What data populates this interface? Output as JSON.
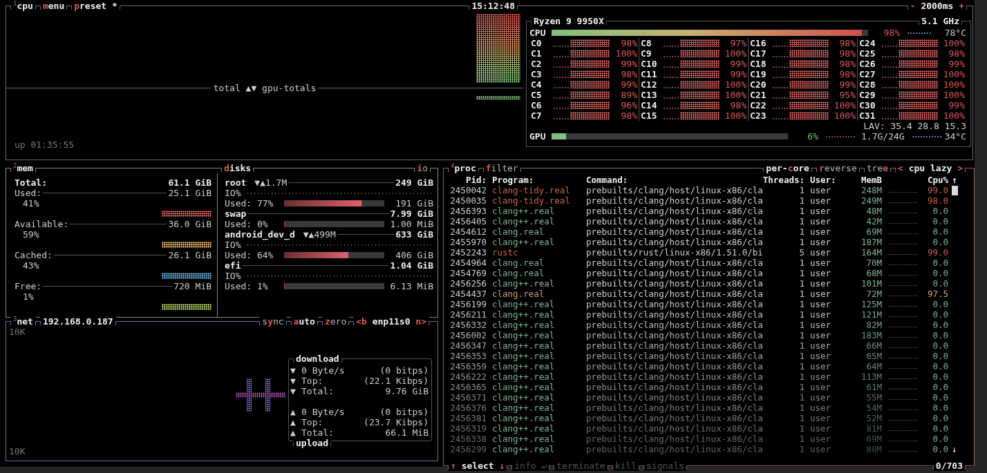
{
  "cpu_panel": {
    "title": "$^{1}$cpu",
    "options": [
      {
        "kind": "button",
        "text": "**m**enu"
      },
      {
        "kind": "button",
        "text": "**p**reset *"
      }
    ],
    "clock": "15:12:48",
    "interval": {
      "minus": "-",
      "value": "2000ms",
      "plus": "+"
    },
    "graph_legend": "total ▲▼ gpu-totals",
    "uptime": "up 01:35:55",
    "cpu_box": {
      "model": "Ryzen 9 9950X",
      "frequency": "5.1 GHz",
      "total": {
        "label": "CPU",
        "level": 0.98,
        "percent": "98%",
        "temperature": "78°C"
      },
      "cores": [
        {
          "label": "C0",
          "value": "98%"
        },
        {
          "label": "C1",
          "value": "100%"
        },
        {
          "label": "C2",
          "value": "99%"
        },
        {
          "label": "C3",
          "value": "98%"
        },
        {
          "label": "C4",
          "value": "99%"
        },
        {
          "label": "C5",
          "value": "89%"
        },
        {
          "label": "C6",
          "value": "96%"
        },
        {
          "label": "C7",
          "value": "98%"
        },
        {
          "label": "C8",
          "value": "97%"
        },
        {
          "label": "C9",
          "value": "100%"
        },
        {
          "label": "C10",
          "value": "99%"
        },
        {
          "label": "C11",
          "value": "99%"
        },
        {
          "label": "C12",
          "value": "100%"
        },
        {
          "label": "C13",
          "value": "100%"
        },
        {
          "label": "C14",
          "value": "98%"
        },
        {
          "label": "C15",
          "value": "100%"
        },
        {
          "label": "C16",
          "value": "98%"
        },
        {
          "label": "C17",
          "value": "98%"
        },
        {
          "label": "C18",
          "value": "98%"
        },
        {
          "label": "C19",
          "value": "98%"
        },
        {
          "label": "C20",
          "value": "99%"
        },
        {
          "label": "C21",
          "value": "95%"
        },
        {
          "label": "C22",
          "value": "100%"
        },
        {
          "label": "C23",
          "value": "100%"
        },
        {
          "label": "C24",
          "value": "100%"
        },
        {
          "label": "C25",
          "value": "98%"
        },
        {
          "label": "C26",
          "value": "99%"
        },
        {
          "label": "C27",
          "value": "100%"
        },
        {
          "label": "C28",
          "value": "100%"
        },
        {
          "label": "C29",
          "value": "100%"
        },
        {
          "label": "C30",
          "value": "99%"
        },
        {
          "label": "C31",
          "value": "100%"
        }
      ],
      "load_average": "LAV: 35.4 28.8 15.3",
      "gpu": {
        "label": "GPU",
        "level": 0.06,
        "percent": "6%",
        "memory": "1.7G/24G",
        "temperature": "34°C"
      }
    }
  },
  "mem_panel": {
    "title": "$^{2}$mem",
    "disks_title": "**d**isks",
    "io_title": "**i**o",
    "total": {
      "label": "Total:",
      "value": "61.1 GiB"
    },
    "items": [
      {
        "label": "Used:",
        "value": "25.1 GiB",
        "percent": "41%",
        "color": "#d05a5a"
      },
      {
        "label": "Available:",
        "value": "36.0 GiB",
        "percent": "59%",
        "color": "#e0a85a"
      },
      {
        "label": "Cached:",
        "value": "26.1 GiB",
        "percent": "43%",
        "color": "#5aa8d8"
      },
      {
        "label": "Free:",
        "value": "720 MiB",
        "percent": "1%",
        "color": "#a8c85a"
      }
    ],
    "disks": [
      {
        "name": "root",
        "io": "▼▲1.7M",
        "size": "249 GiB",
        "io_label": "IO%",
        "used_label": "Used: 77%",
        "level": 0.77,
        "used": "191 GiB"
      },
      {
        "name": "swap",
        "size": "7.99 GiB",
        "used_label": "Used:  0%",
        "level": 0,
        "used": "1.00 MiB"
      },
      {
        "name": "android_dev_d",
        "io": "▼▲499M",
        "size": "633 GiB",
        "io_label": "IO%",
        "used_label": "Used: 64%",
        "level": 0.64,
        "used": "406 GiB"
      },
      {
        "name": "efi",
        "size": "1.04 GiB",
        "io_label": "IO%",
        "used_label": "Used:  1%",
        "level": 0.01,
        "used": "6.13 MiB"
      }
    ]
  },
  "net_panel": {
    "title": "$^{3}$net",
    "address": "192.168.0.187",
    "options": [
      {
        "kind": "toggle",
        "text": "s**y**nc",
        "on": false
      },
      {
        "kind": "toggle",
        "text": "**a**uto",
        "on": true
      },
      {
        "kind": "toggle",
        "text": "**z**ero",
        "on": false
      }
    ],
    "interface": {
      "prev": "<b",
      "label": "enp11s0",
      "next": "n>"
    },
    "scale_top": "10K",
    "scale_bottom": "10K",
    "download": {
      "title": "download",
      "rows": [
        {
          "arrow": "▼",
          "label": "0 Byte/s",
          "value": "(0 bitps)"
        },
        {
          "arrow": "▼",
          "label": "Top:",
          "value": "(22.1 Kibps)"
        },
        {
          "arrow": "▼",
          "label": "Total:",
          "value": "9.76 GiB"
        }
      ]
    },
    "upload": {
      "title": "upload",
      "rows": [
        {
          "arrow": "▲",
          "label": "0 Byte/s",
          "value": "(0 bitps)"
        },
        {
          "arrow": "▲",
          "label": "Top:",
          "value": "(23.7 Kibps)"
        },
        {
          "arrow": "▲",
          "label": "Total:",
          "value": "66.1 MiB"
        }
      ]
    }
  },
  "proc_panel": {
    "title": "$^{4}$proc",
    "options": [
      {
        "kind": "toggle",
        "text": "**f**ilter",
        "on": false
      }
    ],
    "right_options": [
      {
        "kind": "toggle",
        "text": "per-**c**ore",
        "on": true
      },
      {
        "kind": "toggle",
        "text": "**r**everse",
        "on": false
      },
      {
        "kind": "toggle",
        "text": "tre**e**",
        "on": false
      }
    ],
    "sorting": {
      "prev": "<",
      "label": "cpu lazy",
      "next": ">"
    },
    "columns": [
      "Pid:",
      "Program:",
      "Command:",
      "Threads:",
      "User:",
      "MemB",
      "Cpu%"
    ],
    "scrollbar": {
      "up": "↑",
      "down": "↓"
    },
    "rows": [
      {
        "pid": "2450042",
        "program": "clang-tidy.real",
        "command": "prebuilts/clang/host/linux-x86/cla",
        "threads": "1",
        "user": "user",
        "mem": "248M",
        "cpu": "99.0",
        "color": "#c8604c"
      },
      {
        "pid": "2450035",
        "program": "clang-tidy.real",
        "command": "prebuilts/clang/host/linux-x86/cla",
        "threads": "1",
        "user": "user",
        "mem": "249M",
        "cpu": "98.0",
        "color": "#c8604c"
      },
      {
        "pid": "2456393",
        "program": "clang++.real",
        "command": "prebuilts/clang/host/linux-x86/cla",
        "threads": "1",
        "user": "user",
        "mem": "48M",
        "cpu": "0.0",
        "color": "#80b494"
      },
      {
        "pid": "2456405",
        "program": "clang++.real",
        "command": "prebuilts/clang/host/linux-x86/cla",
        "threads": "1",
        "user": "user",
        "mem": "42M",
        "cpu": "0.0",
        "color": "#80b494"
      },
      {
        "pid": "2454612",
        "program": "clang.real",
        "command": "prebuilts/clang/host/linux-x86/cla",
        "threads": "1",
        "user": "user",
        "mem": "69M",
        "cpu": "0.0",
        "color": "#80b494"
      },
      {
        "pid": "2455970",
        "program": "clang++.real",
        "command": "prebuilts/clang/host/linux-x86/cla",
        "threads": "1",
        "user": "user",
        "mem": "187M",
        "cpu": "0.0",
        "color": "#80b494"
      },
      {
        "pid": "2452243",
        "program": "rustc",
        "command": "prebuilts/rust/linux-x86/1.51.0/bi",
        "threads": "5",
        "user": "user",
        "mem": "164M",
        "cpu": "99.0",
        "color": "#c8604c"
      },
      {
        "pid": "2454964",
        "program": "clang.real",
        "command": "prebuilts/clang/host/linux-x86/cla",
        "threads": "1",
        "user": "user",
        "mem": "70M",
        "cpu": "0.0",
        "color": "#80b494"
      },
      {
        "pid": "2454769",
        "program": "clang.real",
        "command": "prebuilts/clang/host/linux-x86/cla",
        "threads": "1",
        "user": "user",
        "mem": "68M",
        "cpu": "0.0",
        "color": "#80b494"
      },
      {
        "pid": "2456256",
        "program": "clang++.real",
        "command": "prebuilts/clang/host/linux-x86/cla",
        "threads": "1",
        "user": "user",
        "mem": "101M",
        "cpu": "0.0",
        "color": "#80b494"
      },
      {
        "pid": "2454437",
        "program": "clang.real",
        "command": "prebuilts/clang/host/linux-x86/cla",
        "threads": "1",
        "user": "user",
        "mem": "72M",
        "cpu": "97.5",
        "color": "#d8a070"
      },
      {
        "pid": "2456199",
        "program": "clang++.real",
        "command": "prebuilts/clang/host/linux-x86/cla",
        "threads": "1",
        "user": "user",
        "mem": "125M",
        "cpu": "0.0",
        "color": "#80b494"
      },
      {
        "pid": "2456211",
        "program": "clang++.real",
        "command": "prebuilts/clang/host/linux-x86/cla",
        "threads": "1",
        "user": "user",
        "mem": "121M",
        "cpu": "0.0",
        "color": "#80b494"
      },
      {
        "pid": "2456332",
        "program": "clang++.real",
        "command": "prebuilts/clang/host/linux-x86/cla",
        "threads": "1",
        "user": "user",
        "mem": "82M",
        "cpu": "0.0",
        "color": "#80b494"
      },
      {
        "pid": "2456002",
        "program": "clang++.real",
        "command": "prebuilts/clang/host/linux-x86/cla",
        "threads": "1",
        "user": "user",
        "mem": "183M",
        "cpu": "0.0",
        "color": "#80b494"
      },
      {
        "pid": "2456347",
        "program": "clang++.real",
        "command": "prebuilts/clang/host/linux-x86/cla",
        "threads": "1",
        "user": "user",
        "mem": "66M",
        "cpu": "0.0",
        "color": "#80b494"
      },
      {
        "pid": "2456353",
        "program": "clang++.real",
        "command": "prebuilts/clang/host/linux-x86/cla",
        "threads": "1",
        "user": "user",
        "mem": "65M",
        "cpu": "0.0",
        "color": "#80b494"
      },
      {
        "pid": "2456359",
        "program": "clang++.real",
        "command": "prebuilts/clang/host/linux-x86/cla",
        "threads": "1",
        "user": "user",
        "mem": "64M",
        "cpu": "0.0",
        "color": "#80b494"
      },
      {
        "pid": "2456222",
        "program": "clang++.real",
        "command": "prebuilts/clang/host/linux-x86/cla",
        "threads": "1",
        "user": "user",
        "mem": "113M",
        "cpu": "0.0",
        "color": "#80b494"
      },
      {
        "pid": "2456365",
        "program": "clang++.real",
        "command": "prebuilts/clang/host/linux-x86/cla",
        "threads": "1",
        "user": "user",
        "mem": "61M",
        "cpu": "0.0",
        "color": "#80b494"
      },
      {
        "pid": "2456371",
        "program": "clang++.real",
        "command": "prebuilts/clang/host/linux-x86/cla",
        "threads": "1",
        "user": "user",
        "mem": "55M",
        "cpu": "0.0",
        "color": "#80b494"
      },
      {
        "pid": "2456376",
        "program": "clang++.real",
        "command": "prebuilts/clang/host/linux-x86/cla",
        "threads": "1",
        "user": "user",
        "mem": "54M",
        "cpu": "0.0",
        "color": "#80b494"
      },
      {
        "pid": "2456381",
        "program": "clang++.real",
        "command": "prebuilts/clang/host/linux-x86/cla",
        "threads": "1",
        "user": "user",
        "mem": "52M",
        "cpu": "0.0",
        "color": "#80b494"
      },
      {
        "pid": "2456319",
        "program": "clang++.real",
        "command": "prebuilts/clang/host/linux-x86/cla",
        "threads": "1",
        "user": "user",
        "mem": "81M",
        "cpu": "0.0",
        "color": "#80b494"
      },
      {
        "pid": "2456338",
        "program": "clang++.real",
        "command": "prebuilts/clang/host/linux-x86/cla",
        "threads": "1",
        "user": "user",
        "mem": "69M",
        "cpu": "0.0",
        "color": "#80b494"
      },
      {
        "pid": "2456299",
        "program": "clang++.real",
        "command": "prebuilts/clang/host/linux-x86/cla",
        "threads": "1",
        "user": "user",
        "mem": "80M",
        "cpu": "0.0",
        "color": "#80b494"
      }
    ],
    "footer": [
      {
        "prefix": "↑",
        "label": "select",
        "suffix": "↓",
        "disabled": false
      },
      {
        "label": "info ↵",
        "disabled": true
      },
      {
        "label": "terminate",
        "disabled": true
      },
      {
        "label": "kill",
        "disabled": true
      },
      {
        "label": "signals",
        "disabled": true
      }
    ],
    "count": "0/703"
  }
}
